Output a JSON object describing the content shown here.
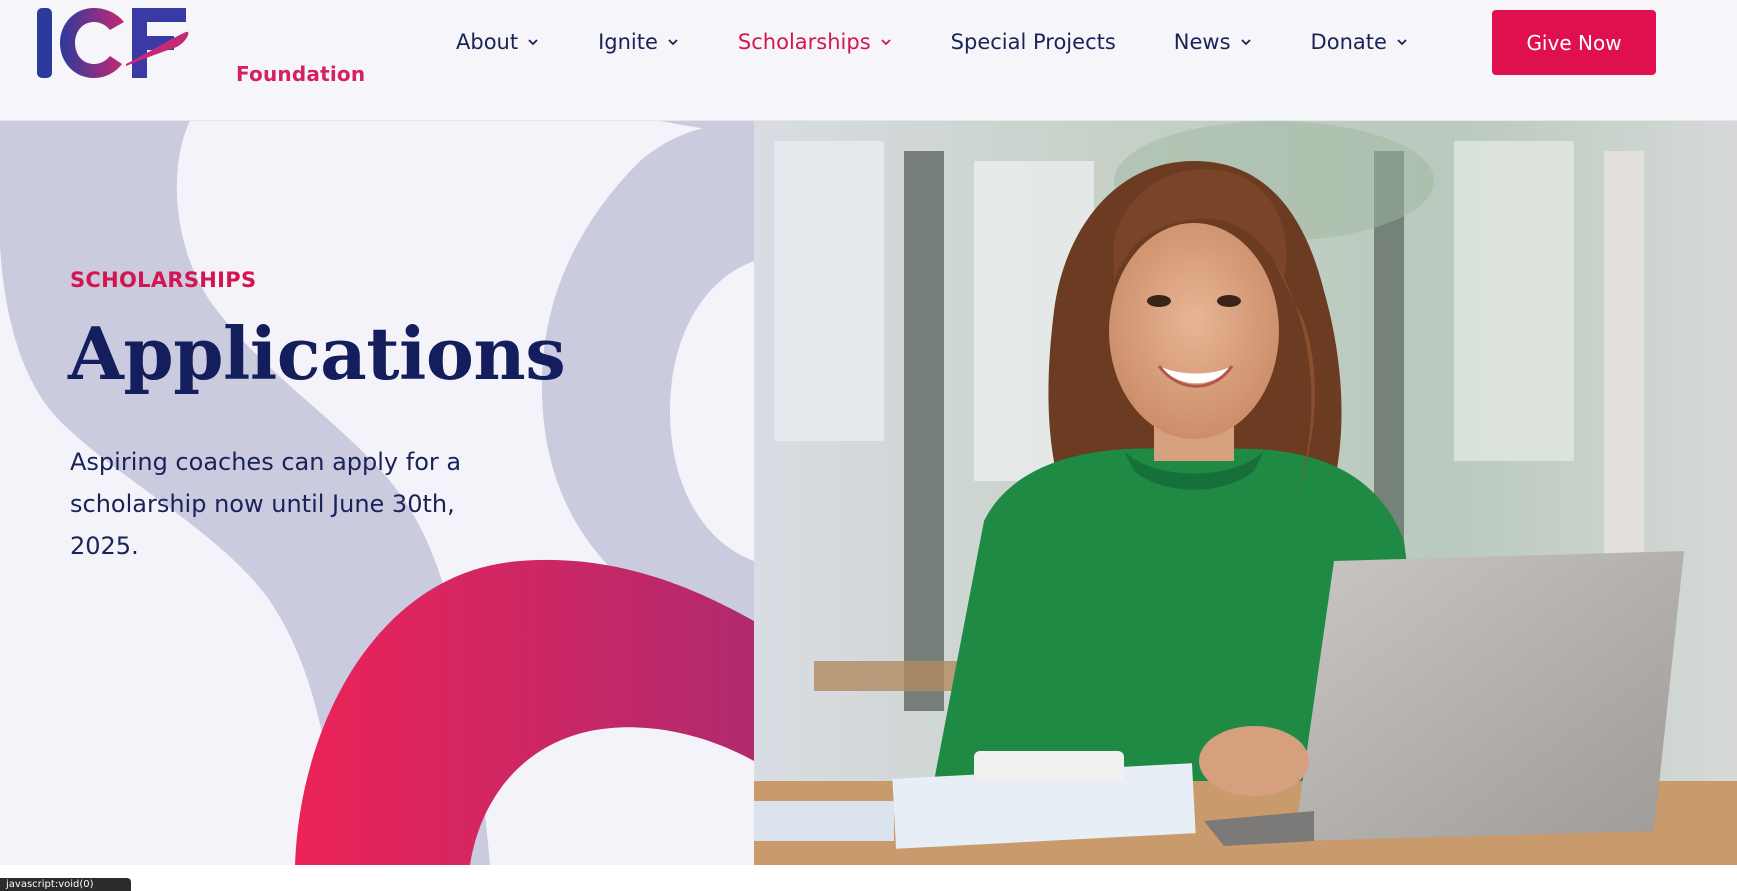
{
  "brand": {
    "logo_text": "ICF",
    "logo_subtext": "Foundation",
    "primary_color": "#e0104f",
    "navy_color": "#151e5c"
  },
  "nav": {
    "items": [
      {
        "label": "About",
        "has_dropdown": true,
        "active": false
      },
      {
        "label": "Ignite",
        "has_dropdown": true,
        "active": false
      },
      {
        "label": "Scholarships",
        "has_dropdown": true,
        "active": true
      },
      {
        "label": "Special Projects",
        "has_dropdown": false,
        "active": false
      },
      {
        "label": "News",
        "has_dropdown": true,
        "active": false
      },
      {
        "label": "Donate",
        "has_dropdown": true,
        "active": false
      }
    ],
    "cta_label": "Give Now"
  },
  "hero": {
    "eyebrow": "SCHOLARSHIPS",
    "title": "Applications",
    "description": "Aspiring coaches can apply for a scholarship now until June 30th, 2025.",
    "image_icon": "photo-woman-laptop-icon"
  },
  "status_bar": {
    "text": "javascript:void(0)"
  }
}
